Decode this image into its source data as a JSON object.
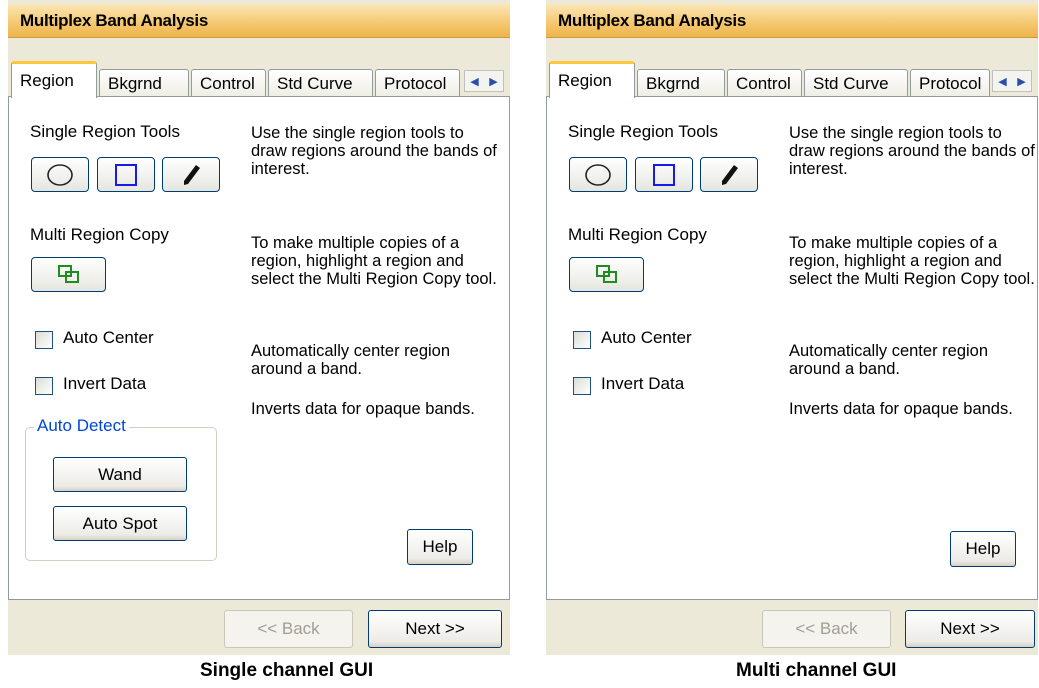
{
  "panels": [
    {
      "title": "Multiplex Band Analysis",
      "tabs": [
        "Region",
        "Bkgrnd",
        "Control",
        "Std Curve",
        "Protocol"
      ],
      "single_region_tools_label": "Single Region Tools",
      "single_region_desc": "Use the single region tools to draw regions around the bands of interest.",
      "multi_region_copy_label": "Multi Region Copy",
      "multi_region_desc": "To make multiple copies of a region, highlight a region and select the Multi Region Copy tool.",
      "auto_center_label": "Auto Center",
      "auto_center_desc": "Automatically center region around a band.",
      "invert_data_label": "Invert Data",
      "invert_data_desc": "Inverts data for opaque bands.",
      "auto_detect_label": "Auto Detect",
      "wand_label": "Wand",
      "auto_spot_label": "Auto Spot",
      "help_label": "Help",
      "back_label": "<< Back",
      "next_label": "Next >>",
      "caption": "Single channel GUI"
    },
    {
      "title": "Multiplex Band Analysis",
      "tabs": [
        "Region",
        "Bkgrnd",
        "Control",
        "Std Curve",
        "Protocol"
      ],
      "single_region_tools_label": "Single Region Tools",
      "single_region_desc": "Use the single region tools to draw regions around the bands of interest.",
      "multi_region_copy_label": "Multi Region Copy",
      "multi_region_desc": "To make multiple copies of a region, highlight a region and select the Multi Region Copy tool.",
      "auto_center_label": "Auto Center",
      "auto_center_desc": "Automatically center region around a band.",
      "invert_data_label": "Invert Data",
      "invert_data_desc": "Inverts data for opaque bands.",
      "help_label": "Help",
      "back_label": "<< Back",
      "next_label": "Next >>",
      "caption": "Multi channel GUI"
    }
  ],
  "icons": {
    "tool_1": "ellipse-icon",
    "tool_2": "rectangle-icon",
    "tool_3": "pencil-icon",
    "copy": "multi-region-copy-icon",
    "scroll_left": "chevron-left-icon",
    "scroll_right": "chevron-right-icon"
  },
  "colors": {
    "title_gradient_top": "#fbe7b8",
    "title_gradient_bottom": "#eeb44c",
    "active_tab_accent": "#ffc83c",
    "group_title": "#0046d5",
    "rect_tool": "#1a1ae6",
    "copy_icon": "#1e8c1e"
  }
}
